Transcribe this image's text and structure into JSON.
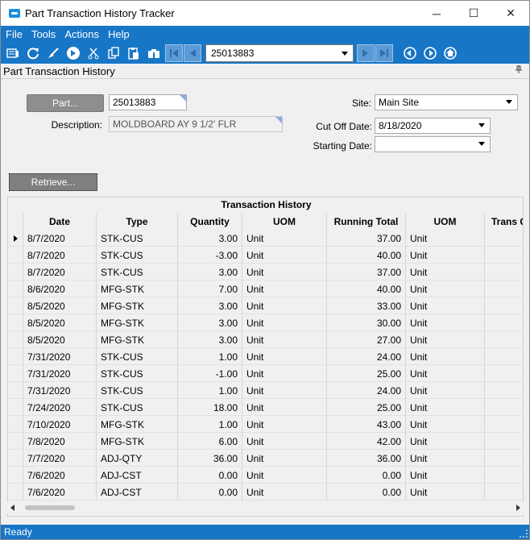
{
  "window": {
    "title": "Part Transaction History Tracker",
    "minimize": "─",
    "maximize": "☐",
    "close": "✕"
  },
  "menu": [
    "File",
    "Tools",
    "Actions",
    "Help"
  ],
  "toolbar": {
    "record_value": "25013883"
  },
  "panel": {
    "title": "Part Transaction History",
    "pin": "ꟷ"
  },
  "form": {
    "part_button": "Part...",
    "part_value": "25013883",
    "description_label": "Description:",
    "description_value": "MOLDBOARD AY 9 1/2' FLR",
    "site_label": "Site:",
    "site_value": "Main Site",
    "cutoff_label": "Cut Off Date:",
    "cutoff_value": "8/18/2020",
    "starting_label": "Starting Date:",
    "starting_value": "",
    "retrieve_button": "Retrieve..."
  },
  "grid": {
    "caption": "Transaction History",
    "columns": [
      "Date",
      "Type",
      "Quantity",
      "UOM",
      "Running Total",
      "UOM",
      "Trans Qu"
    ],
    "rows": [
      [
        "8/7/2020",
        "STK-CUS",
        "3.00",
        "Unit",
        "37.00",
        "Unit"
      ],
      [
        "8/7/2020",
        "STK-CUS",
        "-3.00",
        "Unit",
        "40.00",
        "Unit"
      ],
      [
        "8/7/2020",
        "STK-CUS",
        "3.00",
        "Unit",
        "37.00",
        "Unit"
      ],
      [
        "8/6/2020",
        "MFG-STK",
        "7.00",
        "Unit",
        "40.00",
        "Unit"
      ],
      [
        "8/5/2020",
        "MFG-STK",
        "3.00",
        "Unit",
        "33.00",
        "Unit"
      ],
      [
        "8/5/2020",
        "MFG-STK",
        "3.00",
        "Unit",
        "30.00",
        "Unit"
      ],
      [
        "8/5/2020",
        "MFG-STK",
        "3.00",
        "Unit",
        "27.00",
        "Unit"
      ],
      [
        "7/31/2020",
        "STK-CUS",
        "1.00",
        "Unit",
        "24.00",
        "Unit"
      ],
      [
        "7/31/2020",
        "STK-CUS",
        "-1.00",
        "Unit",
        "25.00",
        "Unit"
      ],
      [
        "7/31/2020",
        "STK-CUS",
        "1.00",
        "Unit",
        "24.00",
        "Unit"
      ],
      [
        "7/24/2020",
        "STK-CUS",
        "18.00",
        "Unit",
        "25.00",
        "Unit"
      ],
      [
        "7/10/2020",
        "MFG-STK",
        "1.00",
        "Unit",
        "43.00",
        "Unit"
      ],
      [
        "7/8/2020",
        "MFG-STK",
        "6.00",
        "Unit",
        "42.00",
        "Unit"
      ],
      [
        "7/7/2020",
        "ADJ-QTY",
        "36.00",
        "Unit",
        "36.00",
        "Unit"
      ],
      [
        "7/6/2020",
        "ADJ-CST",
        "0.00",
        "Unit",
        "0.00",
        "Unit"
      ],
      [
        "7/6/2020",
        "ADJ-CST",
        "0.00",
        "Unit",
        "0.00",
        "Unit"
      ]
    ]
  },
  "status": {
    "text": "Ready"
  },
  "colors": {
    "accent": "#1776c6",
    "button_gray": "#8e8e8e"
  }
}
